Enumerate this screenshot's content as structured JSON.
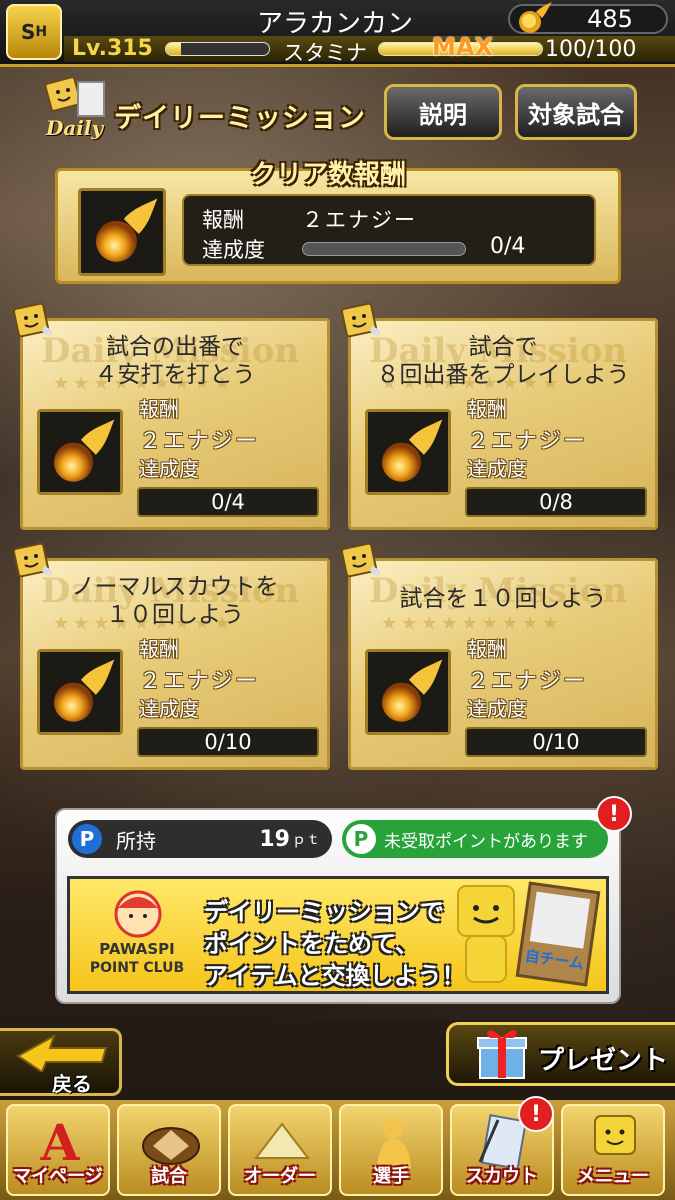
{
  "header": {
    "player_name": "アラカンカン",
    "energy_count": "485",
    "level_prefix": "Lv.",
    "level": "315",
    "stamina_label": "スタミナ",
    "stamina_max_label": "MAX",
    "stamina_value": "100/100",
    "exp_progress": 0.15,
    "stamina_progress": 1.0
  },
  "mission_header": {
    "daily_word": "Daily",
    "title": "デイリーミッション",
    "explain_button": "説明",
    "target_games_button": "対象試合"
  },
  "clear_reward": {
    "heading": "クリア数報酬",
    "reward_label": "報酬",
    "reward_value": "２エナジー",
    "progress_label": "達成度",
    "progress_value": "0/4",
    "progress": 0.0
  },
  "missions": [
    {
      "title_line1": "試合の出番で",
      "title_line2": "４安打を打とう",
      "reward_label": "報酬",
      "reward_value": "２エナジー",
      "progress_label": "達成度",
      "progress_value": "0/4"
    },
    {
      "title_line1": "試合で",
      "title_line2": "８回出番をプレイしよう",
      "reward_label": "報酬",
      "reward_value": "２エナジー",
      "progress_label": "達成度",
      "progress_value": "0/8"
    },
    {
      "title_line1": "ノーマルスカウトを",
      "title_line2": "１０回しよう",
      "reward_label": "報酬",
      "reward_value": "２エナジー",
      "progress_label": "達成度",
      "progress_value": "0/10"
    },
    {
      "title_line1": "試合を１０回しよう",
      "title_line2": "",
      "reward_label": "報酬",
      "reward_value": "２エナジー",
      "progress_label": "達成度",
      "progress_value": "0/10"
    }
  ],
  "points": {
    "owned_label": "所持",
    "owned_value": "19",
    "owned_unit": "ｐｔ",
    "unclaimed_message": "未受取ポイントがあります",
    "alert_mark": "!",
    "p_symbol": "P",
    "club_name_line1": "PAWASPI",
    "club_name_line2": "POINT CLUB",
    "banner_line1": "デイリーミッションで",
    "banner_line2": "ポイントをためて、",
    "banner_line3": "アイテムと交換しよう！",
    "banner_card_text": "自チーム"
  },
  "actions": {
    "back_label": "戻る",
    "present_label": "プレゼント"
  },
  "nav": {
    "items": [
      "マイページ",
      "試合",
      "オーダー",
      "選手",
      "スカウト",
      "メニュー"
    ],
    "scout_alert": "!"
  },
  "colors": {
    "gold": "#d9b64a",
    "alert_red": "#e21f1f",
    "point_blue": "#1f6fd6",
    "point_green": "#27a339",
    "max_orange": "#ff9a1f"
  }
}
